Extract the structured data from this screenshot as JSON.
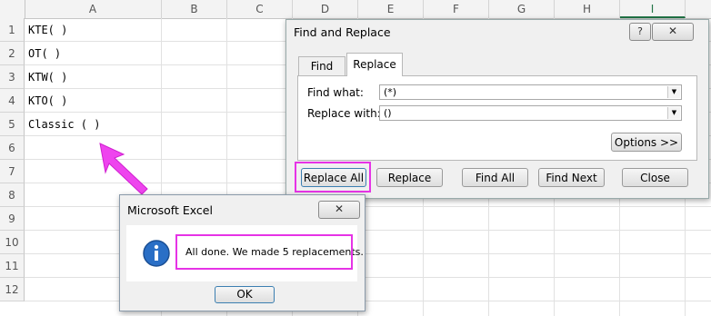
{
  "sheet": {
    "columns": [
      "A",
      "B",
      "C",
      "D",
      "E",
      "F",
      "G",
      "H",
      "I"
    ],
    "rows": [
      "1",
      "2",
      "3",
      "4",
      "5",
      "6",
      "7",
      "8",
      "9",
      "10",
      "11",
      "12"
    ],
    "cells": [
      "KTE( )",
      "OT( )",
      "KTW( )",
      "KTO( )",
      "Classic ( )"
    ]
  },
  "find_replace": {
    "title": "Find and Replace",
    "help": "?",
    "close": "✕",
    "tabs": [
      "Find",
      "Replace"
    ],
    "find_label": "Find what:",
    "find_value": "(*)",
    "replace_label": "Replace with:",
    "replace_value": "()",
    "options_button": "Options >>",
    "buttons": [
      "Replace All",
      "Replace",
      "Find All",
      "Find Next",
      "Close"
    ]
  },
  "message_box": {
    "title": "Microsoft Excel",
    "close": "✕",
    "icon": "info-icon",
    "message": "All done. We made 5 replacements.",
    "ok_button": "OK"
  },
  "colors": {
    "highlight": "#e633e6",
    "info_icon": "#2a6fc6"
  }
}
